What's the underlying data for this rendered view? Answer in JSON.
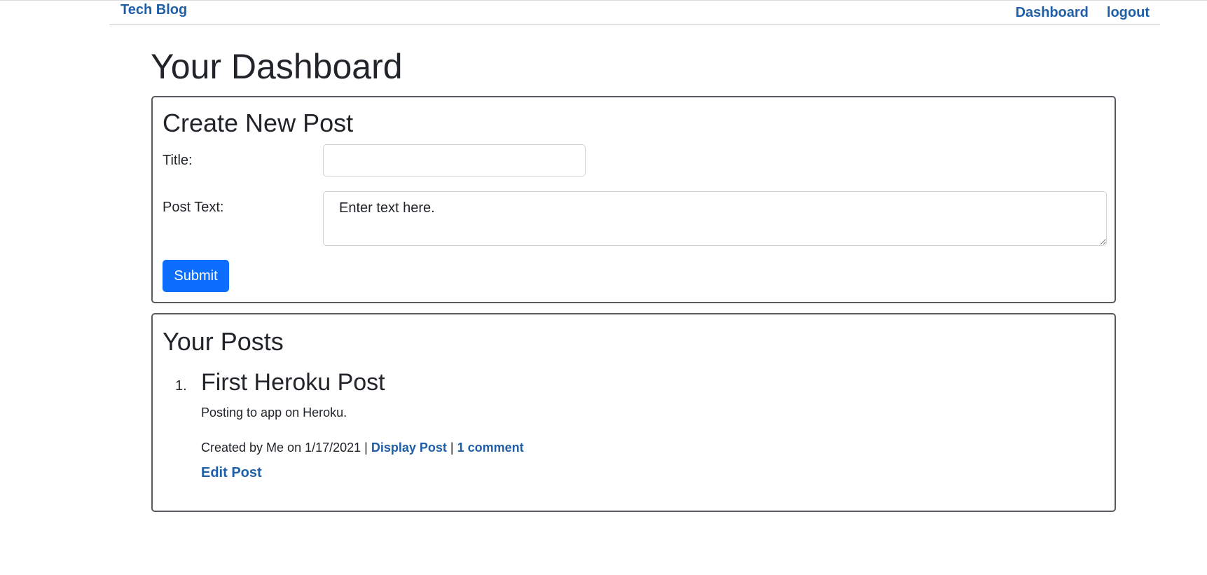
{
  "header": {
    "brand": "Tech Blog",
    "nav": [
      {
        "label": "Dashboard"
      },
      {
        "label": "logout"
      }
    ]
  },
  "main": {
    "title": "Your Dashboard"
  },
  "create_post": {
    "heading": "Create New Post",
    "title_label": "Title:",
    "title_value": "",
    "text_label": "Post Text:",
    "text_placeholder": "Enter text here.",
    "submit_label": "Submit"
  },
  "your_posts": {
    "heading": "Your Posts",
    "posts": [
      {
        "number": "1.",
        "title": "First Heroku Post",
        "body": "Posting to app on Heroku.",
        "created_prefix": "Created by Me on 1/17/2021 | ",
        "display_link": "Display Post",
        "separator": " | ",
        "comments_link": "1 comment",
        "edit_link": "Edit Post"
      }
    ]
  },
  "colors": {
    "link": "#1f5fa8",
    "primary_button": "#0d6efd",
    "card_border": "#5a5a63"
  }
}
